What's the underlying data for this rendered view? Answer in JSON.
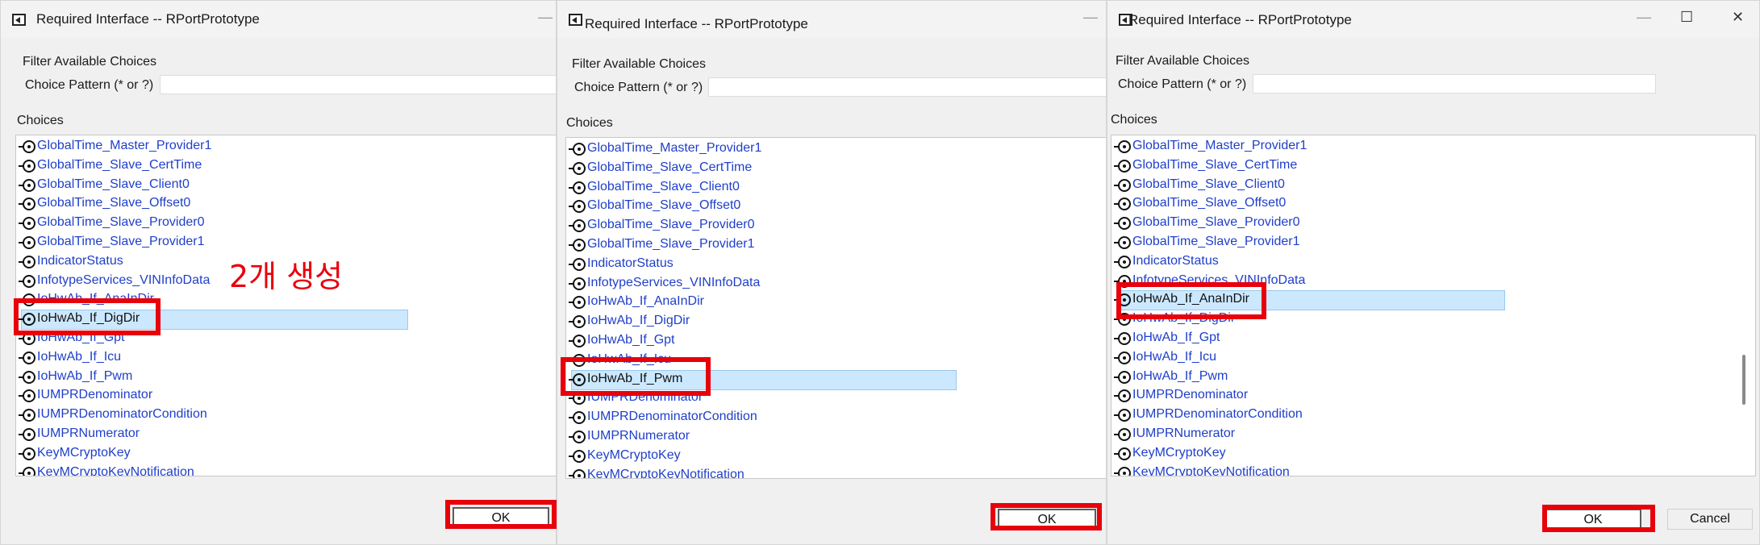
{
  "annotation_color": "#e8000b",
  "annotation_note": "2개 생성",
  "dialogs": [
    {
      "title": "Required Interface -- RPortPrototype",
      "filter_label": "Filter Available Choices",
      "pattern_label": "Choice Pattern (* or ?)",
      "pattern_value": "",
      "choices_label": "Choices",
      "selected": "IoHwAb_If_DigDir",
      "items": [
        "GlobalTime_Master_Provider1",
        "GlobalTime_Slave_CertTime",
        "GlobalTime_Slave_Client0",
        "GlobalTime_Slave_Offset0",
        "GlobalTime_Slave_Provider0",
        "GlobalTime_Slave_Provider1",
        "IndicatorStatus",
        "InfotypeServices_VINInfoData",
        "IoHwAb_If_AnaInDir",
        "IoHwAb_If_DigDir",
        "IoHwAb_If_Gpt",
        "IoHwAb_If_Icu",
        "IoHwAb_If_Pwm",
        "IUMPRDenominator",
        "IUMPRDenominatorCondition",
        "IUMPRNumerator",
        "KeyMCryptoKey",
        "KeyMCryptoKeyNotification"
      ],
      "ok_label": "OK"
    },
    {
      "title": "Required Interface -- RPortPrototype",
      "filter_label": "Filter Available Choices",
      "pattern_label": "Choice Pattern (* or ?)",
      "pattern_value": "",
      "choices_label": "Choices",
      "selected": "IoHwAb_If_Pwm",
      "items": [
        "GlobalTime_Master_Provider1",
        "GlobalTime_Slave_CertTime",
        "GlobalTime_Slave_Client0",
        "GlobalTime_Slave_Offset0",
        "GlobalTime_Slave_Provider0",
        "GlobalTime_Slave_Provider1",
        "IndicatorStatus",
        "InfotypeServices_VINInfoData",
        "IoHwAb_If_AnaInDir",
        "IoHwAb_If_DigDir",
        "IoHwAb_If_Gpt",
        "IoHwAb_If_Icu",
        "IoHwAb_If_Pwm",
        "IUMPRDenominator",
        "IUMPRDenominatorCondition",
        "IUMPRNumerator",
        "KeyMCryptoKey",
        "KeyMCryptoKeyNotification"
      ],
      "ok_label": "OK"
    },
    {
      "title": "Required Interface -- RPortPrototype",
      "filter_label": "Filter Available Choices",
      "pattern_label": "Choice Pattern (* or ?)",
      "pattern_value": "",
      "choices_label": "Choices",
      "selected": "IoHwAb_If_AnaInDir",
      "items": [
        "GlobalTime_Master_Provider1",
        "GlobalTime_Slave_CertTime",
        "GlobalTime_Slave_Client0",
        "GlobalTime_Slave_Offset0",
        "GlobalTime_Slave_Provider0",
        "GlobalTime_Slave_Provider1",
        "IndicatorStatus",
        "InfotypeServices_VINInfoData",
        "IoHwAb_If_AnaInDir",
        "IoHwAb_If_DigDir",
        "IoHwAb_If_Gpt",
        "IoHwAb_If_Icu",
        "IoHwAb_If_Pwm",
        "IUMPRDenominator",
        "IUMPRDenominatorCondition",
        "IUMPRNumerator",
        "KeyMCryptoKey",
        "KeyMCryptoKeyNotification"
      ],
      "ok_label": "OK",
      "cancel_label": "Cancel",
      "minimize_glyph": "—",
      "maximize_glyph": "☐",
      "close_glyph": "✕"
    }
  ]
}
